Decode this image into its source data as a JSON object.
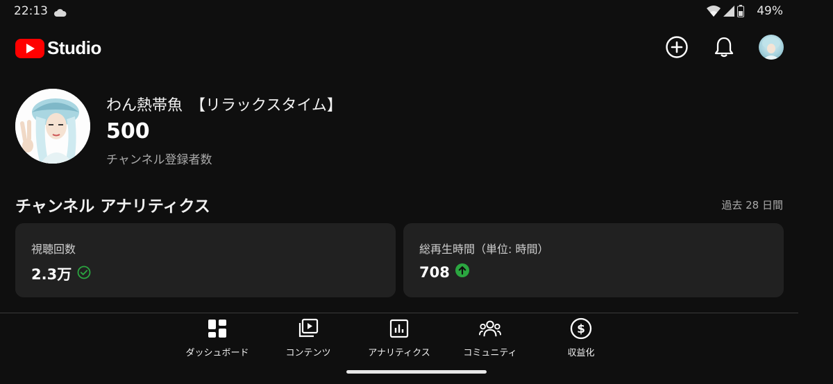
{
  "status_bar": {
    "time": "22:13",
    "battery_percent": "49%",
    "icons": [
      "cloud-icon",
      "wifi-icon",
      "signal-icon",
      "battery-icon"
    ]
  },
  "app_bar": {
    "logo_text": "Studio",
    "brand_color": "#ff0000",
    "actions": [
      "create-icon",
      "bell-icon",
      "avatar"
    ]
  },
  "channel": {
    "name": "わん熱帯魚　【リラックスタイム】",
    "subscribers": "500",
    "subscribers_label": "チャンネル登録者数"
  },
  "analytics": {
    "title": "チャンネル アナリティクス",
    "period": "過去 28 日間",
    "cards": [
      {
        "label": "視聴回数",
        "value": "2.3万",
        "status_icon": "check-circle-icon",
        "status_color": "#2ba640"
      },
      {
        "label": "総再生時間（単位: 時間）",
        "value": "708",
        "status_icon": "arrow-up-circle-icon",
        "status_color": "#2ba640"
      }
    ]
  },
  "bottom_nav": {
    "items": [
      {
        "label": "ダッシュボード",
        "icon": "dashboard-icon"
      },
      {
        "label": "コンテンツ",
        "icon": "content-icon"
      },
      {
        "label": "アナリティクス",
        "icon": "analytics-icon"
      },
      {
        "label": "コミュニティ",
        "icon": "community-icon"
      },
      {
        "label": "収益化",
        "icon": "monetization-icon"
      }
    ]
  }
}
